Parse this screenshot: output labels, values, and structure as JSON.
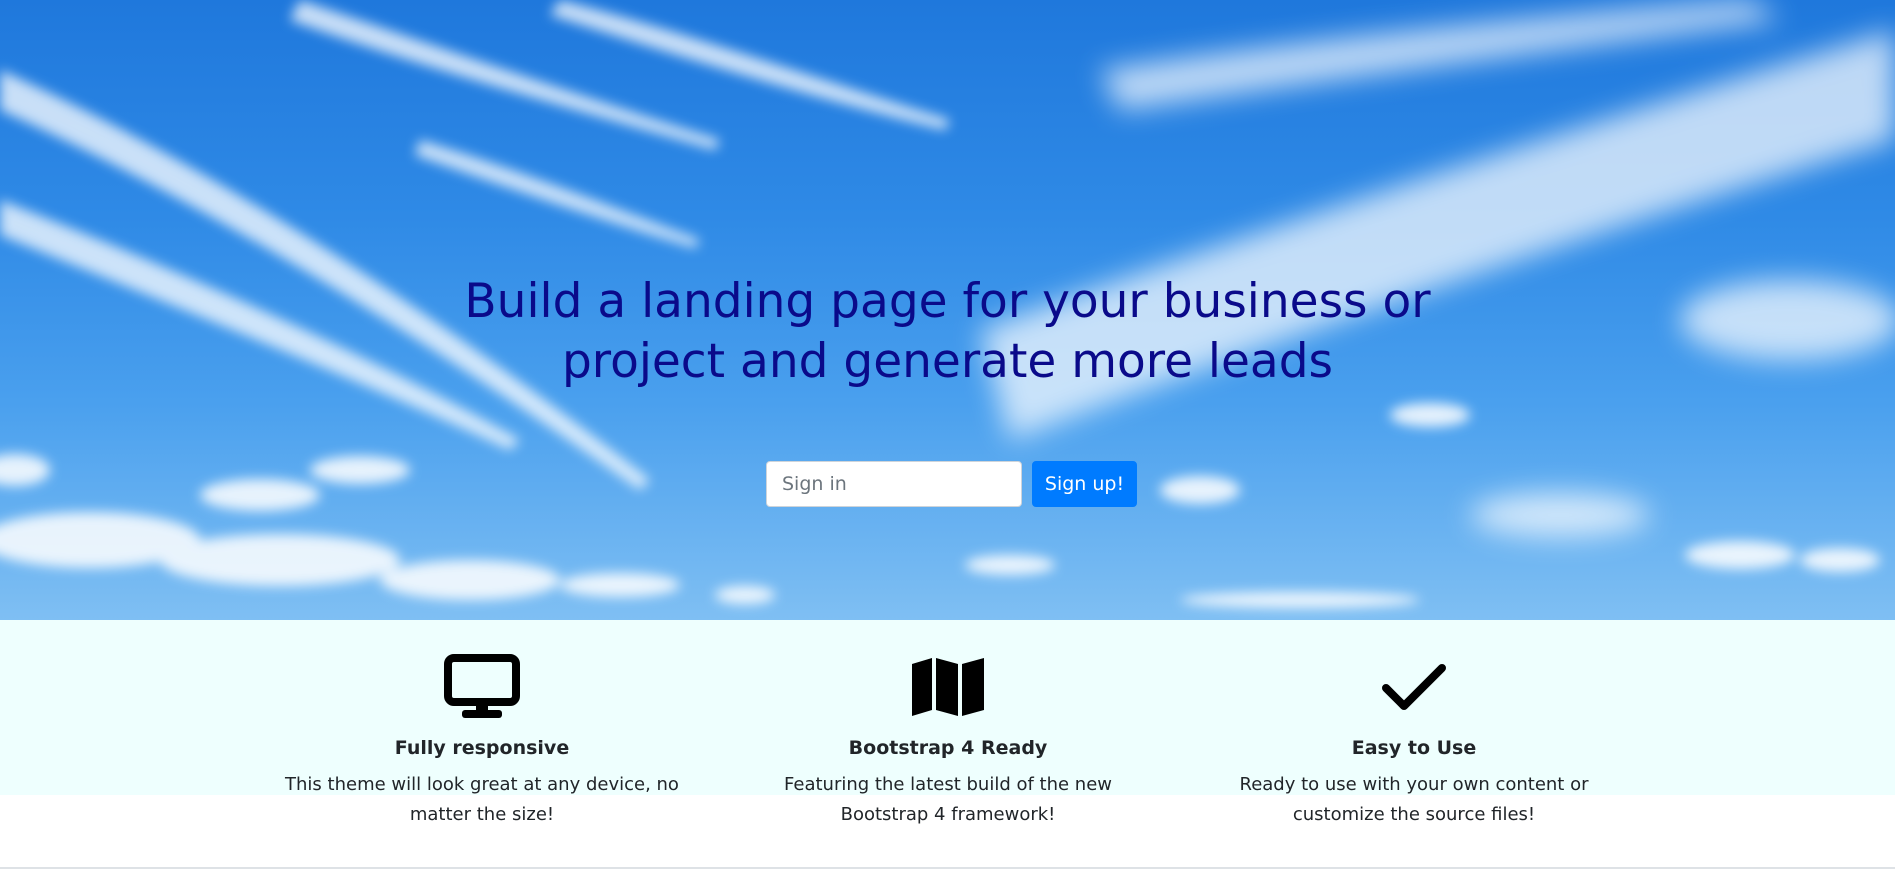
{
  "hero": {
    "title_line1": "Build a landing page for your business or",
    "title_line2": "project and generate more leads",
    "signin_placeholder": "Sign in",
    "signup_label": "Sign up!",
    "title_color": "#0a0a8a",
    "button_color": "#007bff"
  },
  "features": [
    {
      "icon": "desktop-icon",
      "title": "Fully responsive",
      "text": "This theme will look great at any device, no matter the size!"
    },
    {
      "icon": "map-icon",
      "title": "Bootstrap 4 Ready",
      "text": "Featuring the latest build of the new Bootstrap 4 framework!"
    },
    {
      "icon": "check-icon",
      "title": "Easy to Use",
      "text": "Ready to use with your own content or customize the source files!"
    }
  ],
  "colors": {
    "features_background": "#eefffe",
    "text": "#212529"
  }
}
